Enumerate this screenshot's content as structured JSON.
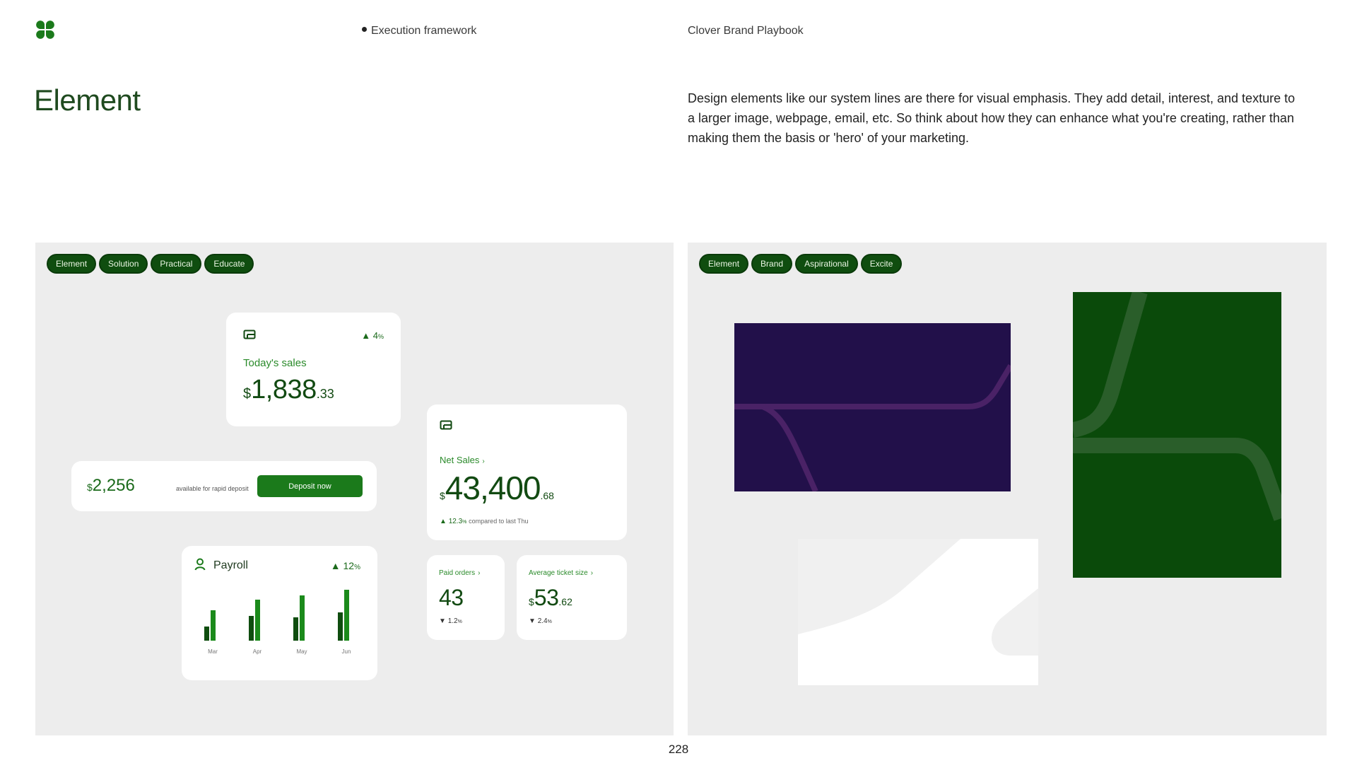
{
  "header": {
    "section": "Execution framework",
    "document": "Clover Brand Playbook",
    "logo_icon": "clover-logo-icon"
  },
  "page": {
    "title": "Element",
    "intro": "Design elements like our system lines are there for visual emphasis. They add detail, interest, and texture to a larger image, webpage, email, etc. So think about how they can enhance what you're creating, rather than making them the basis or 'hero' of your marketing.",
    "page_number": "228"
  },
  "left_panel": {
    "tags": [
      "Element",
      "Solution",
      "Practical",
      "Educate"
    ],
    "todays_sales": {
      "delta_arrow": "▲",
      "delta": "4",
      "delta_unit": "%",
      "label": "Today's sales",
      "currency": "$",
      "amount": "1,838",
      "cents": ".33"
    },
    "deposit": {
      "currency": "$",
      "amount": "2,256",
      "note": "available for rapid deposit",
      "button": "Deposit now"
    },
    "payroll": {
      "label": "Payroll",
      "delta_arrow": "▲",
      "delta": "12",
      "delta_unit": "%",
      "months": [
        "Mar",
        "Apr",
        "May",
        "Jun"
      ]
    },
    "net_sales": {
      "label": "Net Sales",
      "chevron": "›",
      "currency": "$",
      "amount": "43,400",
      "cents": ".68",
      "compare_arrow": "▲",
      "compare_value": "12.3",
      "compare_unit": "%",
      "compare_text": "compared to last Thu"
    },
    "paid_orders": {
      "label": "Paid orders",
      "chevron": "›",
      "value": "43",
      "change_arrow": "▼",
      "change": "1.2",
      "change_unit": "%"
    },
    "avg_ticket": {
      "label": "Average ticket size",
      "chevron": "›",
      "currency": "$",
      "amount": "53",
      "cents": ".62",
      "change_arrow": "▼",
      "change": "2.4",
      "change_unit": "%"
    }
  },
  "right_panel": {
    "tags": [
      "Element",
      "Brand",
      "Aspirational",
      "Excite"
    ]
  },
  "colors": {
    "brand_green": "#0f4d0f",
    "accent_green": "#1b7a1b",
    "purple": "#22104a",
    "panel_bg": "#ededed"
  }
}
